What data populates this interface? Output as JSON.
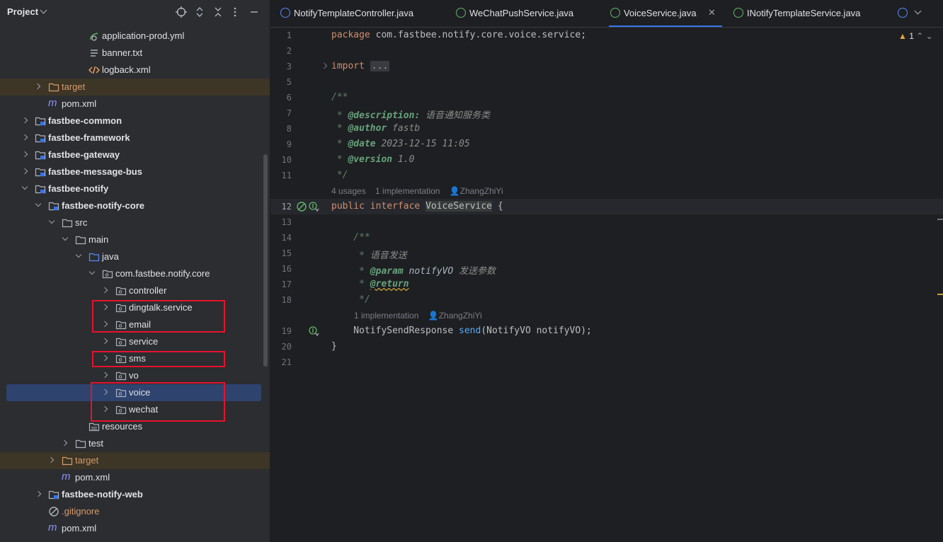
{
  "project": {
    "title": "Project",
    "tree": [
      {
        "label": "application-prod.yml",
        "icon": "yaml-file-icon"
      },
      {
        "label": "banner.txt",
        "icon": "text-file-icon"
      },
      {
        "label": "logback.xml",
        "icon": "xml-file-icon"
      },
      {
        "label": "target",
        "icon": "folder-icon"
      },
      {
        "label": "pom.xml",
        "icon": "maven-icon"
      },
      {
        "label": "fastbee-common",
        "icon": "module-folder-icon"
      },
      {
        "label": "fastbee-framework",
        "icon": "module-folder-icon"
      },
      {
        "label": "fastbee-gateway",
        "icon": "module-folder-icon"
      },
      {
        "label": "fastbee-message-bus",
        "icon": "module-folder-icon"
      },
      {
        "label": "fastbee-notify",
        "icon": "module-folder-icon"
      },
      {
        "label": "fastbee-notify-core",
        "icon": "module-folder-icon"
      },
      {
        "label": "src",
        "icon": "folder-icon"
      },
      {
        "label": "main",
        "icon": "folder-icon"
      },
      {
        "label": "java",
        "icon": "source-folder-icon"
      },
      {
        "label": "com.fastbee.notify.core",
        "icon": "package-icon"
      },
      {
        "label": "controller",
        "icon": "package-icon"
      },
      {
        "label": "dingtalk.service",
        "icon": "package-icon"
      },
      {
        "label": "email",
        "icon": "package-icon"
      },
      {
        "label": "service",
        "icon": "package-icon"
      },
      {
        "label": "sms",
        "icon": "package-icon"
      },
      {
        "label": "vo",
        "icon": "package-icon"
      },
      {
        "label": "voice",
        "icon": "package-icon"
      },
      {
        "label": "wechat",
        "icon": "package-icon"
      },
      {
        "label": "resources",
        "icon": "resources-folder-icon"
      },
      {
        "label": "test",
        "icon": "folder-icon"
      },
      {
        "label": "target",
        "icon": "folder-icon"
      },
      {
        "label": "pom.xml",
        "icon": "maven-icon"
      },
      {
        "label": "fastbee-notify-web",
        "icon": "module-folder-icon"
      },
      {
        "label": ".gitignore",
        "icon": "ignore-file-icon"
      },
      {
        "label": "pom.xml",
        "icon": "maven-icon"
      }
    ]
  },
  "tabs": [
    {
      "label": "NotifyTemplateController.java",
      "icon": "class-icon"
    },
    {
      "label": "WeChatPushService.java",
      "icon": "service-icon"
    },
    {
      "label": "VoiceService.java",
      "icon": "interface-icon",
      "active": true
    },
    {
      "label": "INotifyTemplateService.java",
      "icon": "interface-icon"
    }
  ],
  "editor": {
    "warnings": "1",
    "line_numbers": [
      "1",
      "2",
      "3",
      "5",
      "6",
      "7",
      "8",
      "9",
      "10",
      "11",
      "12",
      "13",
      "14",
      "15",
      "16",
      "17",
      "18",
      "19",
      "20",
      "21"
    ],
    "code": {
      "l1_kw": "package",
      "l1_rest": " com.fastbee.notify.core.voice.service;",
      "l3_kw": "import",
      "l3_fold": "...",
      "l6": "/**",
      "l7_star": " * ",
      "l7_tag": "@description:",
      "l7_val": " 语音通知服务类",
      "l8_star": " * ",
      "l8_tag": "@author",
      "l8_val": " fastb",
      "l9_star": " * ",
      "l9_tag": "@date",
      "l9_val": " 2023-12-15 11:05",
      "l10_star": " * ",
      "l10_tag": "@version",
      "l10_val": " 1.0",
      "l11": " */",
      "l12_kw1": "public",
      "l12_kw2": "interface",
      "l12_name": "VoiceService",
      "l12_brace": " {",
      "l14": "    /**",
      "l15_star": "     * ",
      "l15_val": "语音发送",
      "l16_star": "     * ",
      "l16_tag": "@param",
      "l16_val": " notifyVO",
      "l16_desc": " 发送参数",
      "l17_star": "     * ",
      "l17_tag": "@return",
      "l18": "     */",
      "l19_type": "    NotifySendResponse ",
      "l19_fn": "send",
      "l19_rest": "(NotifyVO notifyVO);",
      "l20": "}"
    },
    "inlay1": {
      "usages": "4 usages",
      "impl": "1 implementation",
      "author": "ZhangZhiYi"
    },
    "inlay2": {
      "impl": "1 implementation",
      "author": "ZhangZhiYi"
    }
  }
}
